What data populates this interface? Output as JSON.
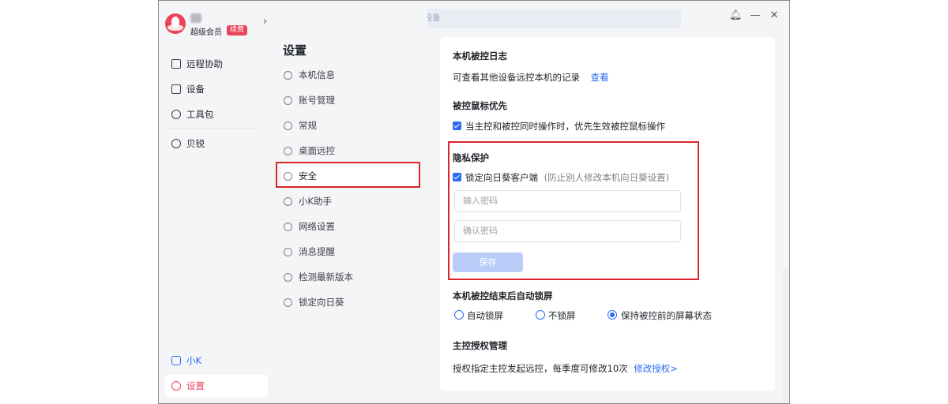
{
  "user": {
    "member_label": "超级会员",
    "renew_label": "续费"
  },
  "search": {
    "placeholder": "搜索/连接设备"
  },
  "left_nav": {
    "items": [
      {
        "label": "远程协助",
        "icon": "remote-assist-icon"
      },
      {
        "label": "设备",
        "icon": "device-icon"
      },
      {
        "label": "工具包",
        "icon": "toolkit-icon"
      },
      {
        "label": "贝锐",
        "icon": "oray-icon"
      }
    ],
    "bottom": [
      {
        "label": "小K",
        "icon": "assistant-icon"
      },
      {
        "label": "设置",
        "icon": "settings-icon"
      }
    ]
  },
  "settings_menu": {
    "title": "设置",
    "items": [
      {
        "label": "本机信息",
        "icon": "device-info-icon"
      },
      {
        "label": "账号管理",
        "icon": "account-icon"
      },
      {
        "label": "常规",
        "icon": "general-icon"
      },
      {
        "label": "桌面远控",
        "icon": "desktop-remote-icon"
      },
      {
        "label": "安全",
        "icon": "shield-icon"
      },
      {
        "label": "小K助手",
        "icon": "assistant-icon"
      },
      {
        "label": "网络设置",
        "icon": "globe-icon"
      },
      {
        "label": "消息提醒",
        "icon": "message-icon"
      },
      {
        "label": "检测最新版本",
        "icon": "update-icon"
      },
      {
        "label": "锁定向日葵",
        "icon": "lock-icon"
      }
    ],
    "selected": "安全"
  },
  "content": {
    "log": {
      "title": "本机被控日志",
      "desc": "可查看其他设备远控本机的记录",
      "link": "查看"
    },
    "mouse": {
      "title": "被控鼠标优先",
      "option": "当主控和被控同时操作时，优先生效被控鼠标操作",
      "checked": true
    },
    "privacy": {
      "title": "隐私保护",
      "lock_label": "锁定向日葵客户端",
      "lock_note": "(防止别人修改本机向日葵设置)",
      "checked": true,
      "password_placeholder": "输入密码",
      "confirm_placeholder": "确认密码",
      "save_label": "保存"
    },
    "autolock": {
      "title": "本机被控结束后自动锁屏",
      "options": [
        "自动锁屏",
        "不锁屏",
        "保持被控前的屏幕状态"
      ],
      "selected": "保持被控前的屏幕状态"
    },
    "auth": {
      "title": "主控授权管理",
      "desc": "授权指定主控发起远控，每季度可修改10次",
      "link": "修改授权>"
    }
  },
  "colors": {
    "accent": "#2a6bf2",
    "brand": "#e9445a",
    "highlight": "#d9262c"
  }
}
